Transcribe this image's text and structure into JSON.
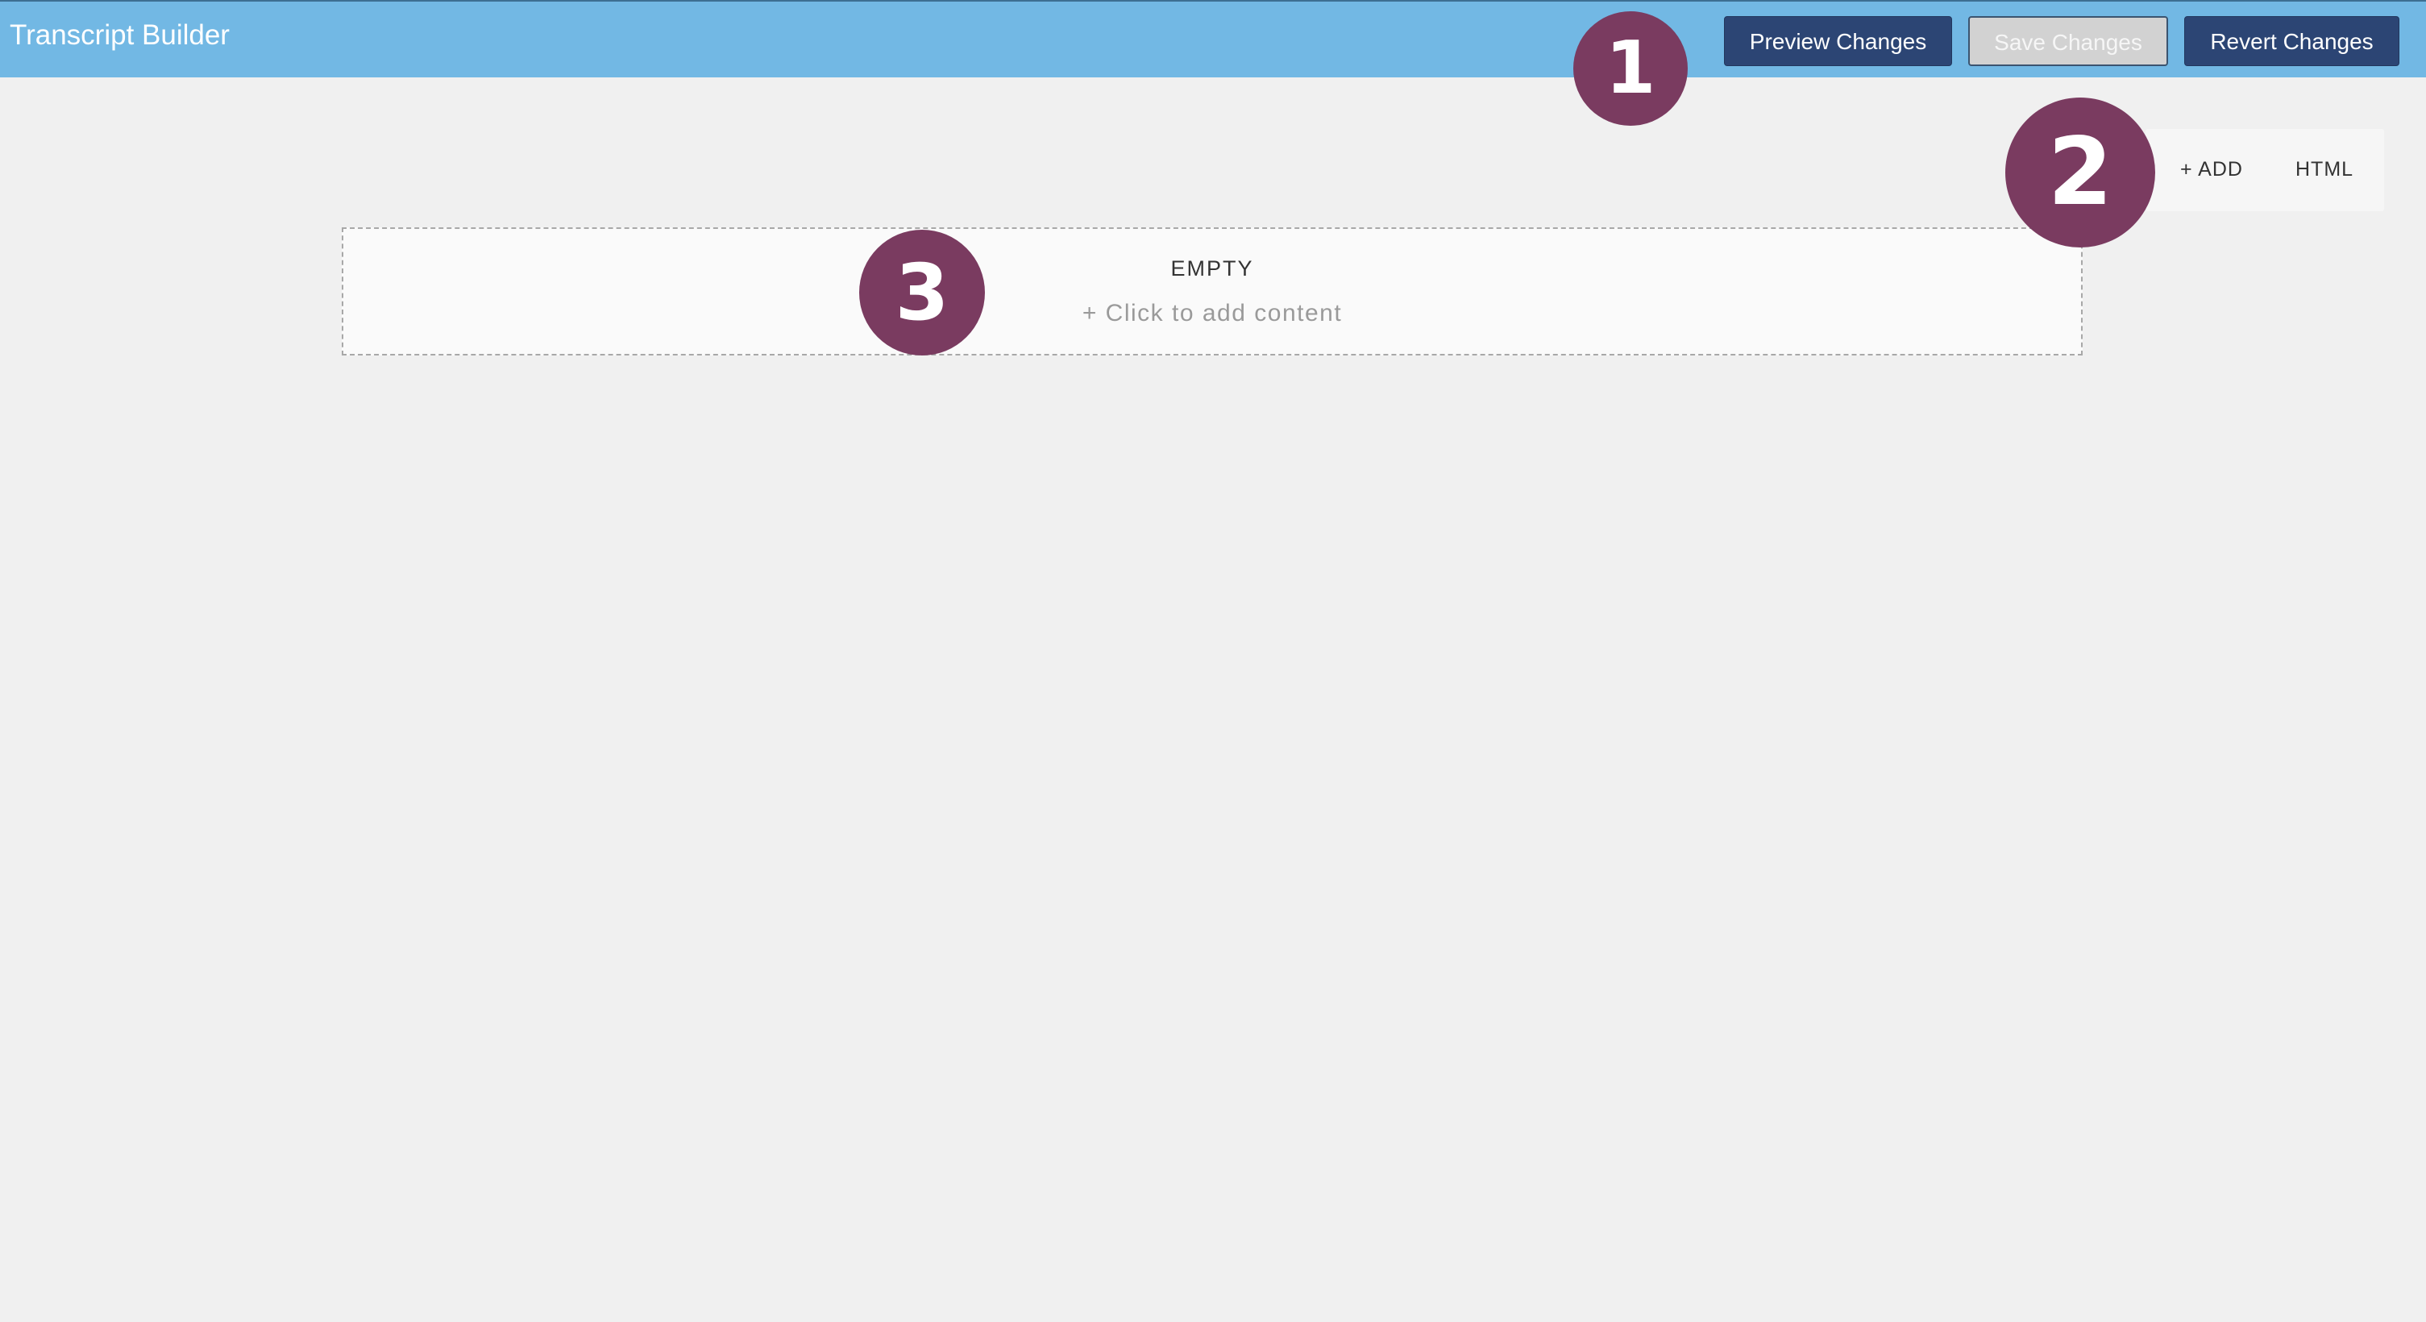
{
  "header": {
    "title": "Transcript Builder",
    "buttons": {
      "preview": "Preview Changes",
      "save": "Save Changes",
      "revert": "Revert Changes"
    }
  },
  "toolbar": {
    "add_label": "+ ADD",
    "html_label": "HTML"
  },
  "content": {
    "empty_title": "EMPTY",
    "empty_hint": "+ Click to add content"
  },
  "annotations": [
    "1",
    "2",
    "3"
  ],
  "colors": {
    "header_bg": "#72b8e4",
    "primary_button": "#2c4574",
    "disabled_button": "#d2d2d2",
    "badge": "#7a3b60",
    "page_bg": "#f0f0f0"
  }
}
